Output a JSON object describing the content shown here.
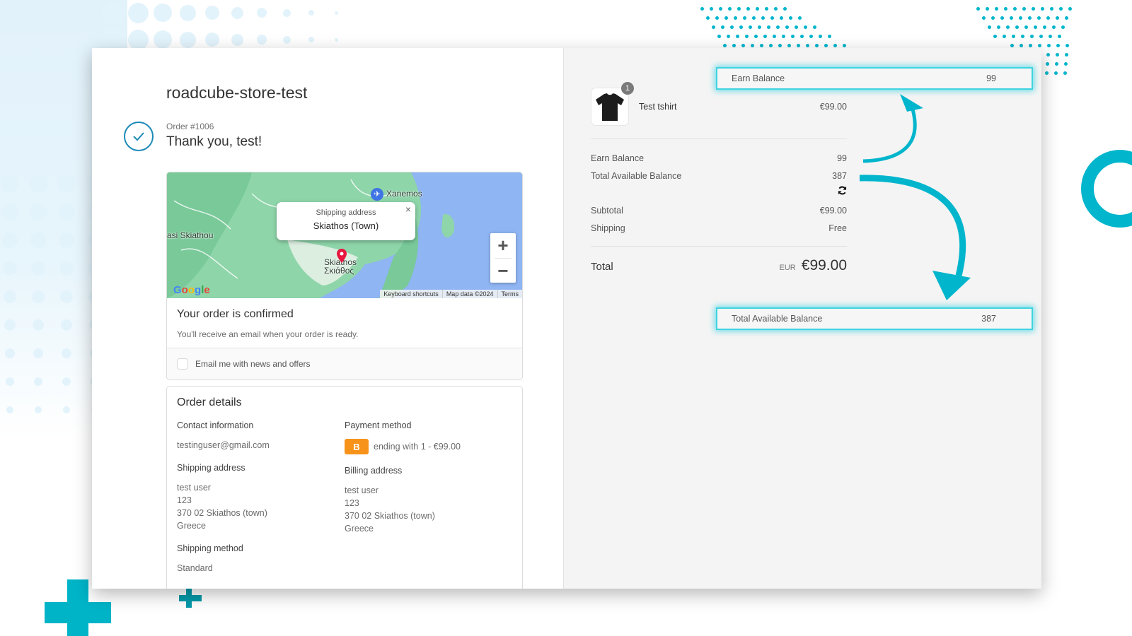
{
  "store": {
    "name": "roadcube-store-test"
  },
  "order": {
    "number": "Order #1006",
    "thank_you": "Thank you, test!"
  },
  "map": {
    "popup_title": "Shipping address",
    "popup_place": "Skiathos (Town)",
    "labels": {
      "airport": "Xanemos",
      "airport_sub": "Σκιάθος",
      "town": "Skiathos",
      "town_greek": "Σκιάθος",
      "area": "asi Skiathou"
    },
    "zoom_in": "+",
    "zoom_out": "−",
    "close": "×",
    "logo": "Google",
    "attribution": [
      "Keyboard shortcuts",
      "Map data ©2024",
      "Terms"
    ]
  },
  "confirmation": {
    "title": "Your order is confirmed",
    "subtitle": "You'll receive an email when your order is ready.",
    "email_opt_in": "Email me with news and offers",
    "email_opt_in_checked": false
  },
  "details": {
    "title": "Order details",
    "contact": {
      "label": "Contact information",
      "value": "testinguser@gmail.com"
    },
    "payment": {
      "label": "Payment method",
      "badge": "B",
      "value": "ending with 1 - €99.00"
    },
    "shipping_address": {
      "label": "Shipping address",
      "lines": [
        "test user",
        "123",
        "370 02 Skiathos (town)",
        "Greece"
      ]
    },
    "billing_address": {
      "label": "Billing address",
      "lines": [
        "test user",
        "123",
        "370 02 Skiathos (town)",
        "Greece"
      ]
    },
    "shipping_method": {
      "label": "Shipping method",
      "value": "Standard"
    }
  },
  "summary": {
    "product": {
      "name": "Test tshirt",
      "price": "€99.00",
      "quantity": "1"
    },
    "earn_balance": {
      "label": "Earn Balance",
      "value": "99"
    },
    "total_available": {
      "label": "Total Available Balance",
      "value": "387"
    },
    "subtotal": {
      "label": "Subtotal",
      "value": "€99.00"
    },
    "shipping": {
      "label": "Shipping",
      "value": "Free"
    },
    "total": {
      "label": "Total",
      "currency": "EUR",
      "value": "€99.00"
    }
  },
  "highlights": {
    "earn_balance": {
      "label": "Earn Balance",
      "value": "99"
    },
    "total_available": {
      "label": "Total Available Balance",
      "value": "387"
    }
  },
  "colors": {
    "accent": "#00b5cc",
    "payment_badge": "#f7931a",
    "check": "#1d8ab8"
  }
}
